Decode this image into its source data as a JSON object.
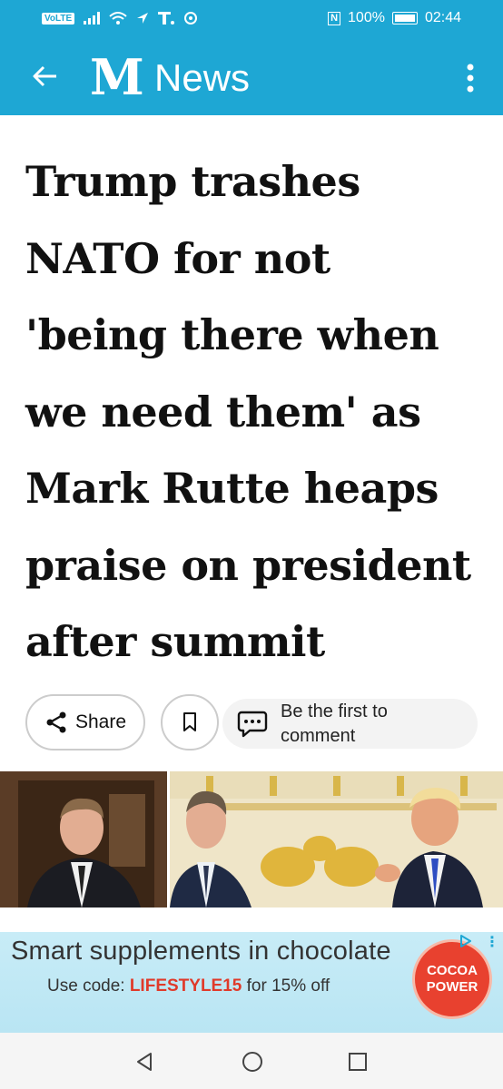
{
  "status_bar": {
    "volte": "VoLTE",
    "nfc": "N",
    "battery": "100%",
    "time": "02:44"
  },
  "app_bar": {
    "logo": "M",
    "title": "News",
    "background": "#1ea7d4"
  },
  "article": {
    "headline": "Trump trashes NATO for not 'being there when we need them' as Mark Rutte heaps praise on president after summit"
  },
  "actions": {
    "share_label": "Share",
    "comment_label": "Be the first to comment"
  },
  "ad": {
    "title": "Smart supplements in chocolate",
    "code_prefix": "Use code: ",
    "code": "LIFESTYLE15",
    "code_suffix": " for 15% off",
    "brand_line1": "COCOA",
    "brand_line2": "POWER"
  },
  "icons": {
    "back": "arrow-left-icon",
    "menu": "more-vertical-icon",
    "share": "share-icon",
    "bookmark": "bookmark-icon",
    "comment": "comment-icon"
  }
}
